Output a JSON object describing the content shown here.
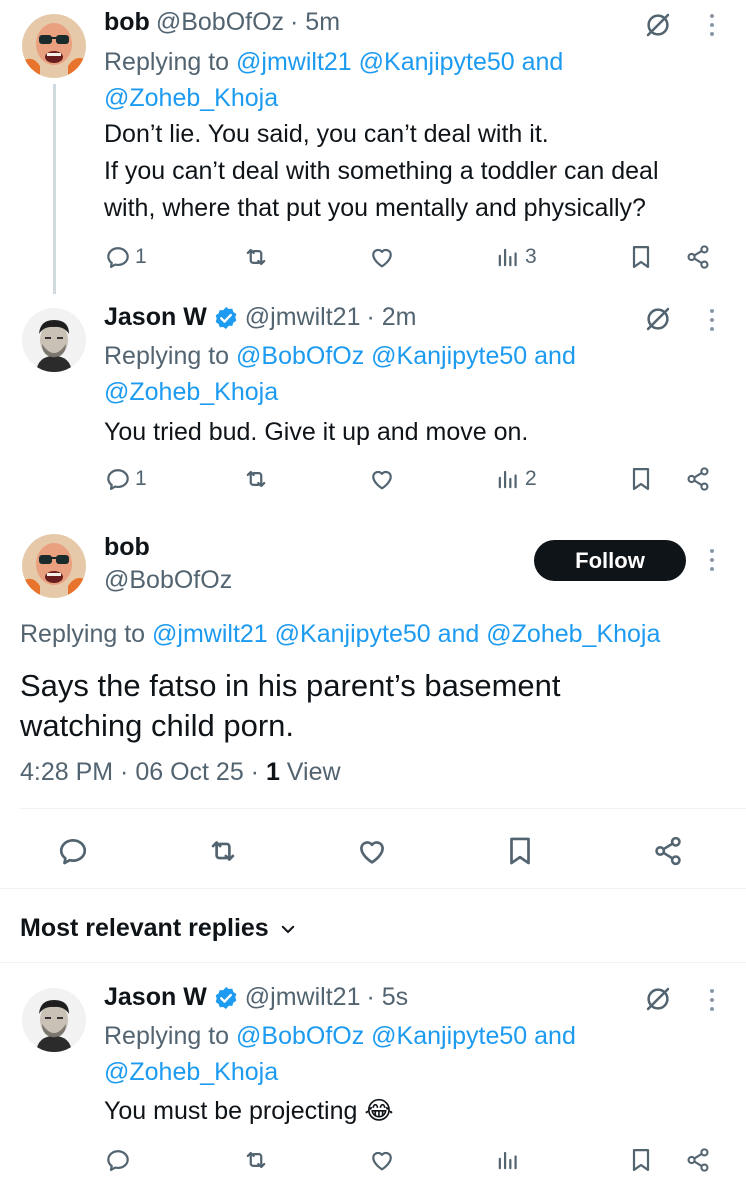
{
  "thread": [
    {
      "name": "bob",
      "handle": "@BobOfOz",
      "time": "· 5m",
      "replying_prefix": "Replying to",
      "replying_line1_links": "@jmwilt21 @Kanjipyte50 and",
      "replying_line2": "@Zoheb_Khoja",
      "text_lines": [
        "Don’t lie. You said, you can’t deal with it.",
        "If you can’t deal with something a toddler can deal",
        "with, where that put you mentally and physically?"
      ],
      "replies": "1",
      "views": "3"
    },
    {
      "name": "Jason W",
      "handle": "@jmwilt21",
      "time": "· 2m",
      "replying_prefix": "Replying to",
      "replying_line1_links": "@BobOfOz @Kanjipyte50 and",
      "replying_line2": "@Zoheb_Khoja",
      "text_lines": [
        "You tried bud. Give it up and move on."
      ],
      "replies": "1",
      "views": "2"
    }
  ],
  "focused": {
    "name": "bob",
    "handle": "@BobOfOz",
    "follow_label": "Follow",
    "replying_prefix": "Replying to",
    "replying_links": "@jmwilt21 @Kanjipyte50 and @Zoheb_Khoja",
    "text_line1": "Says the fatso in his parent’s basement",
    "text_line2": "watching child porn.",
    "timestamp": "4:28 PM · 06 Oct 25 · ",
    "view_count": "1",
    "view_label": "View"
  },
  "replies_section": {
    "title": "Most relevant replies"
  },
  "reply": {
    "name": "Jason W",
    "handle": "@jmwilt21",
    "time": "· 5s",
    "replying_prefix": "Replying to",
    "replying_line1_links": "@BobOfOz @Kanjipyte50 and",
    "replying_line2": "@Zoheb_Khoja",
    "text": "You must be projecting",
    "emoji": "😂"
  },
  "colors": {
    "link": "#1d9bf0",
    "secondary_text": "#536471",
    "verified": "#1d9bf0",
    "follow_bg": "#0f1419"
  }
}
